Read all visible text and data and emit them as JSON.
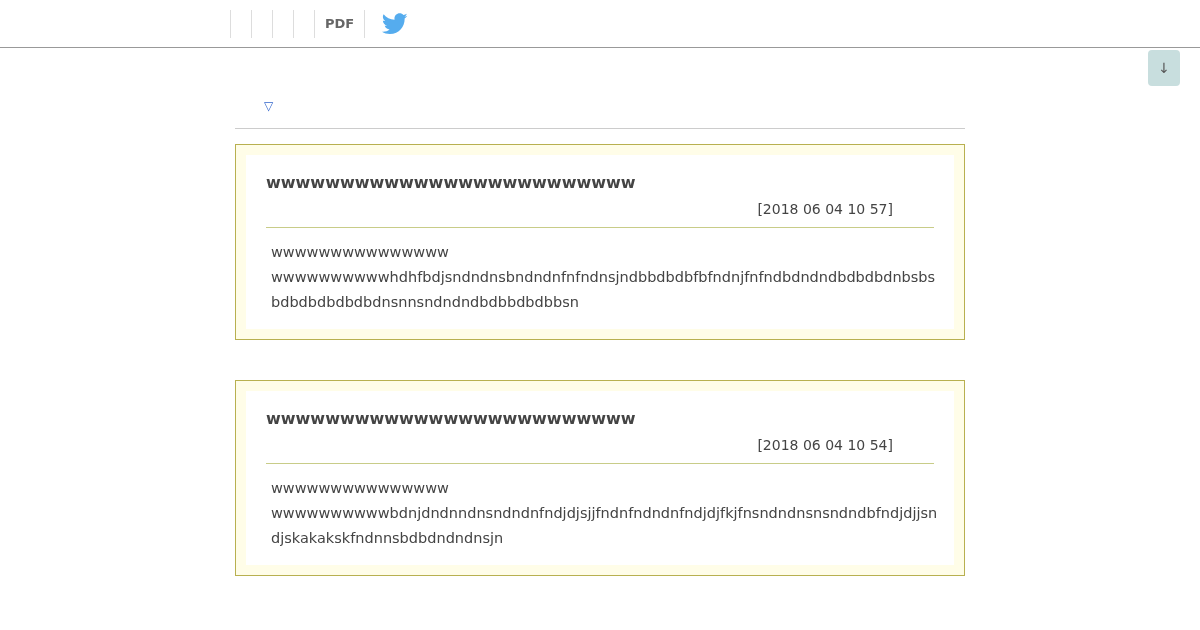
{
  "nav": {
    "pdf_label": "PDF"
  },
  "scroll_button": {
    "label": "↓"
  },
  "toggle": {
    "label": "▽"
  },
  "posts": [
    {
      "title": "wwwwwwwwwwwwwwwwwwwwwwwww",
      "date": "[2018 06 04 10 57]",
      "lines": [
        "wwwwwwwwwwwwwww",
        "wwwwwwwwwwhdhfbdjsndndnsbndndnfnfndnsjndbbdbdbfbfndnjfnfndbdndndbdbdbdnbsbs",
        "bdbdbdbdbdbdnsnnsndndndbdbbdbdbbsn"
      ]
    },
    {
      "title": "wwwwwwwwwwwwwwwwwwwwwwwww",
      "date": "[2018 06 04 10 54]",
      "lines": [
        "wwwwwwwwwwwwwww",
        "wwwwwwwwwwbdnjdndnndnsndndnfndjdjsjjfndnfndndnfndjdjfkjfnsndndnsnsndndbfndjdjjsn",
        "djskakakskfndnnsbdbdndndnsjn"
      ]
    }
  ]
}
